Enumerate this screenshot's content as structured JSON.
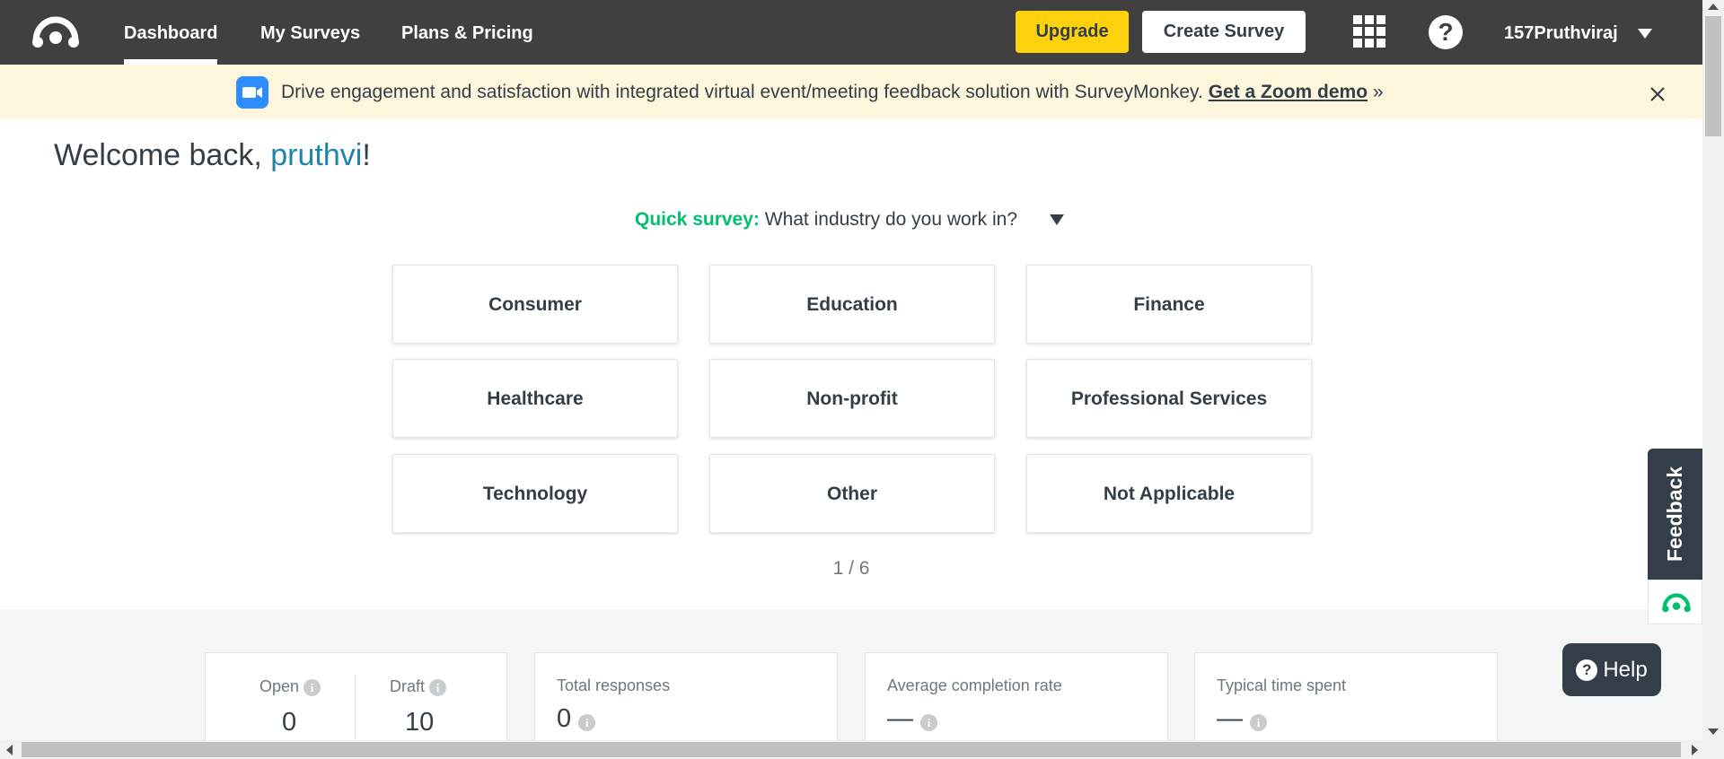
{
  "nav": {
    "links": [
      "Dashboard",
      "My Surveys",
      "Plans & Pricing"
    ],
    "upgrade_label": "Upgrade",
    "create_label": "Create Survey",
    "username": "157Pruthviraj"
  },
  "banner": {
    "text": "Drive engagement and satisfaction with integrated virtual event/meeting feedback solution with SurveyMonkey.",
    "link_text": "Get a Zoom demo",
    "link_suffix": "»"
  },
  "welcome": {
    "prefix": "Welcome back,",
    "name": "pruthvi",
    "suffix": "!"
  },
  "quick_survey": {
    "label": "Quick survey:",
    "question": "What industry do you work in?",
    "options": [
      "Consumer",
      "Education",
      "Finance",
      "Healthcare",
      "Non-profit",
      "Professional Services",
      "Technology",
      "Other",
      "Not Applicable"
    ],
    "pager": "1 / 6"
  },
  "stats": {
    "open_label": "Open",
    "open_value": "0",
    "draft_label": "Draft",
    "draft_value": "10",
    "total_responses_label": "Total responses",
    "total_responses_value": "0",
    "avg_completion_label": "Average completion rate",
    "avg_completion_value": "—",
    "typical_time_label": "Typical time spent",
    "typical_time_value": "—"
  },
  "feedback_label": "Feedback",
  "help_label": "Help",
  "colors": {
    "nav_bg": "#404040",
    "upgrade": "#fdd10b",
    "banner_bg": "#fdf6dd",
    "accent_green": "#00bf6f",
    "username_blue": "#1f84a8",
    "dark": "#333e48"
  },
  "icons": [
    "surveymonkey-logo-icon",
    "apps-grid-icon",
    "help-circle-icon",
    "caret-down-icon",
    "zoom-video-icon",
    "close-icon",
    "info-icon"
  ]
}
